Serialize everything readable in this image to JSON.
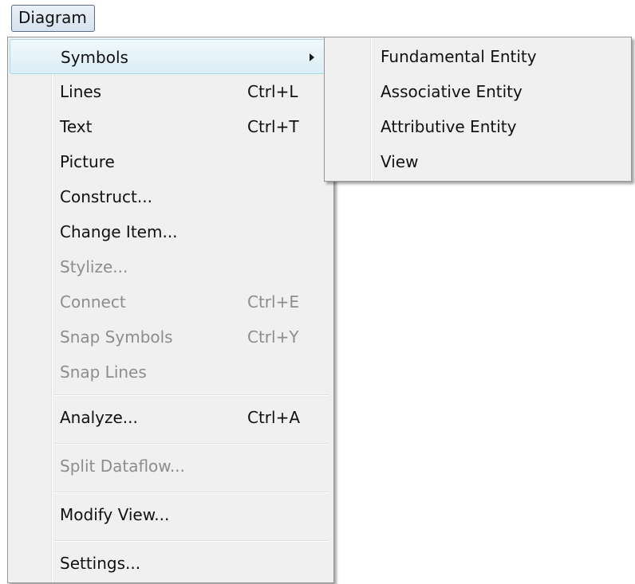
{
  "menubar": {
    "title": "Diagram"
  },
  "menu": {
    "items": [
      {
        "label": "Symbols",
        "shortcut": ""
      },
      {
        "label": "Lines",
        "shortcut": "Ctrl+L"
      },
      {
        "label": "Text",
        "shortcut": "Ctrl+T"
      },
      {
        "label": "Picture",
        "shortcut": ""
      },
      {
        "label": "Construct...",
        "shortcut": ""
      },
      {
        "label": "Change Item...",
        "shortcut": ""
      },
      {
        "label": "Stylize...",
        "shortcut": ""
      },
      {
        "label": "Connect",
        "shortcut": "Ctrl+E"
      },
      {
        "label": "Snap Symbols",
        "shortcut": "Ctrl+Y"
      },
      {
        "label": "Snap Lines",
        "shortcut": ""
      },
      {
        "label": "Analyze...",
        "shortcut": "Ctrl+A"
      },
      {
        "label": "Split Dataflow...",
        "shortcut": ""
      },
      {
        "label": "Modify View...",
        "shortcut": ""
      },
      {
        "label": "Settings...",
        "shortcut": ""
      }
    ]
  },
  "submenu": {
    "items": [
      {
        "label": "Fundamental Entity"
      },
      {
        "label": "Associative Entity"
      },
      {
        "label": "Attributive Entity"
      },
      {
        "label": "View"
      }
    ]
  },
  "colors": {
    "menu_bg": "#f0f0f0",
    "highlight_border": "#a8d8eb",
    "disabled_text": "#8d8d8d"
  }
}
